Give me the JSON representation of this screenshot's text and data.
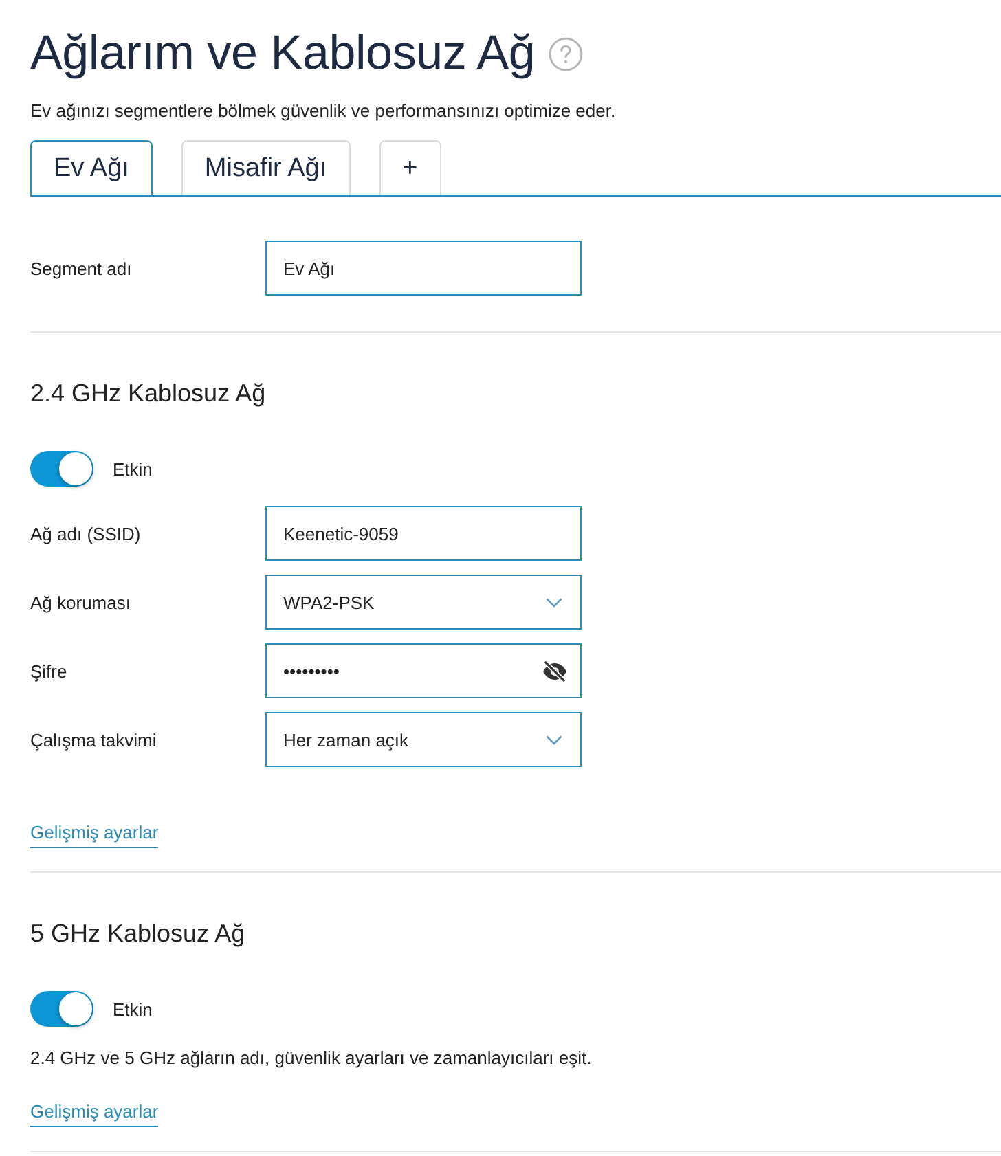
{
  "page": {
    "title": "Ağlarım ve Kablosuz Ağ",
    "subtitle": "Ev ağınızı segmentlere bölmek güvenlik ve performansınızı optimize eder."
  },
  "tabs": [
    {
      "label": "Ev Ağı",
      "selected": true
    },
    {
      "label": "Misafir Ağı",
      "selected": false
    },
    {
      "label": "+",
      "selected": false
    }
  ],
  "segment": {
    "label": "Segment adı",
    "value": "Ev Ağı"
  },
  "sections": [
    {
      "title": "2.4 GHz Kablosuz Ağ",
      "toggle": {
        "label": "Etkin",
        "on": true
      },
      "fields": [
        {
          "kind": "text",
          "label": "Ağ adı (SSID)",
          "value": "Keenetic-9059"
        },
        {
          "kind": "select",
          "label": "Ağ koruması",
          "value": "WPA2-PSK"
        },
        {
          "kind": "password",
          "label": "Şifre",
          "value": "•••••••••"
        },
        {
          "kind": "select",
          "label": "Çalışma takvimi",
          "value": "Her zaman açık"
        }
      ],
      "link": "Gelişmiş ayarlar"
    },
    {
      "title": "5 GHz Kablosuz Ağ",
      "toggle": {
        "label": "Etkin",
        "on": true
      },
      "note": "2.4 GHz ve 5 GHz ağların adı, güvenlik ayarları ve zamanlayıcıları eşit.",
      "link": "Gelişmiş ayarlar"
    }
  ]
}
